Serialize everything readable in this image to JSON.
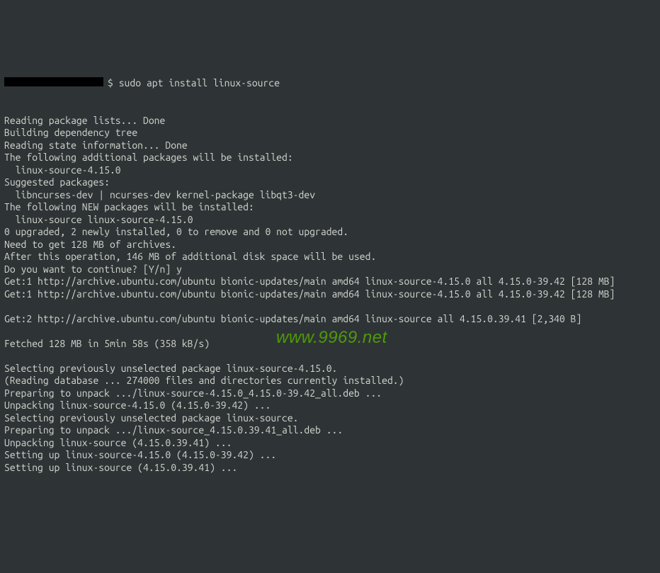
{
  "prompt": {
    "symbol": "$ ",
    "command": "sudo apt install linux-source"
  },
  "output": [
    "Reading package lists... Done",
    "Building dependency tree",
    "Reading state information... Done",
    "The following additional packages will be installed:",
    "  linux-source-4.15.0",
    "Suggested packages:",
    "  libncurses-dev | ncurses-dev kernel-package libqt3-dev",
    "The following NEW packages will be installed:",
    "  linux-source linux-source-4.15.0",
    "0 upgraded, 2 newly installed, 0 to remove and 0 not upgraded.",
    "Need to get 128 MB of archives.",
    "After this operation, 146 MB of additional disk space will be used.",
    "Do you want to continue? [Y/n] y",
    "Get:1 http://archive.ubuntu.com/ubuntu bionic-updates/main amd64 linux-source-4.15.0 all 4.15.0-39.42 [128 MB]",
    "Get:1 http://archive.ubuntu.com/ubuntu bionic-updates/main amd64 linux-source-4.15.0 all 4.15.0-39.42 [128 MB]",
    "",
    "Get:2 http://archive.ubuntu.com/ubuntu bionic-updates/main amd64 linux-source all 4.15.0.39.41 [2,340 B]",
    "",
    "Fetched 128 MB in 5min 58s (358 kB/s)",
    "",
    "Selecting previously unselected package linux-source-4.15.0.",
    "(Reading database ... 274000 files and directories currently installed.)",
    "Preparing to unpack .../linux-source-4.15.0_4.15.0-39.42_all.deb ...",
    "Unpacking linux-source-4.15.0 (4.15.0-39.42) ...",
    "Selecting previously unselected package linux-source.",
    "Preparing to unpack .../linux-source_4.15.0.39.41_all.deb ...",
    "Unpacking linux-source (4.15.0.39.41) ...",
    "Setting up linux-source-4.15.0 (4.15.0-39.42) ...",
    "Setting up linux-source (4.15.0.39.41) ..."
  ],
  "watermark": "www.9969.net"
}
